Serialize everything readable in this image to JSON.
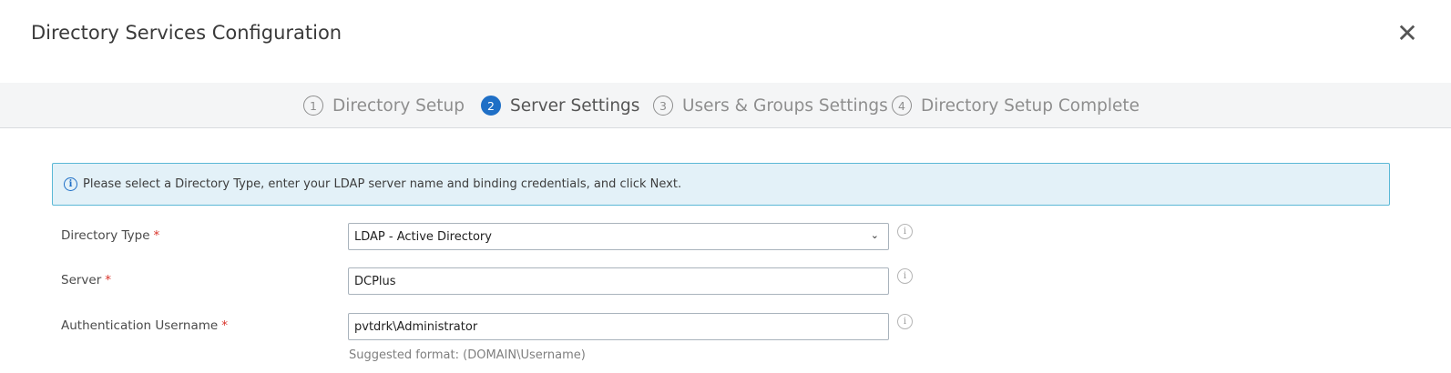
{
  "dialog": {
    "title": "Directory Services Configuration",
    "close_glyph": "✕"
  },
  "steps": [
    {
      "number": "1",
      "label": "Directory Setup",
      "active": false
    },
    {
      "number": "2",
      "label": "Server Settings",
      "active": true
    },
    {
      "number": "3",
      "label": "Users & Groups Settings",
      "active": false
    },
    {
      "number": "4",
      "label": "Directory Setup Complete",
      "active": false
    }
  ],
  "info": {
    "icon": "info-icon",
    "message": "Please select a Directory Type, enter your LDAP server name and binding credentials, and click Next."
  },
  "form": {
    "required_mark": "*",
    "directory_type": {
      "label": "Directory Type",
      "value": "LDAP - Active Directory"
    },
    "server": {
      "label": "Server",
      "value": "DCPlus"
    },
    "auth_username": {
      "label": "Authentication Username",
      "value": "pvtdrk\\Administrator",
      "hint": "Suggested format: (DOMAIN\\Username)"
    }
  },
  "colors": {
    "accent": "#1f6fc6",
    "info_background": "#e3f1f8",
    "info_border": "#5bb8d6",
    "required": "#d9342b"
  }
}
